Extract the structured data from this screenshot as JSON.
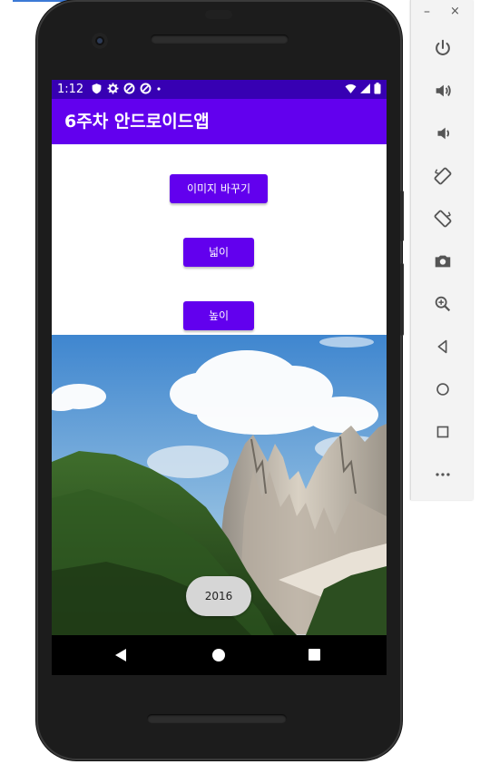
{
  "status_bar": {
    "time": "1:12"
  },
  "app": {
    "title": "6주차 안드로이드앱"
  },
  "buttons": {
    "change_image": "이미지 바꾸기",
    "wide": "넓이",
    "high": "높이"
  },
  "toast": {
    "text": "2016"
  },
  "emulator": {
    "minimize": "–",
    "close": "×",
    "tools": [
      "power-icon",
      "volume-up-icon",
      "volume-down-icon",
      "rotate-left-icon",
      "rotate-right-icon",
      "camera-icon",
      "zoom-icon",
      "back-icon",
      "home-icon",
      "overview-icon",
      "more-icon"
    ]
  },
  "colors": {
    "status_bar": "#3700b3",
    "app_bar": "#6200ee",
    "button": "#6200ee",
    "toast_bg": "#d6d6d6"
  }
}
